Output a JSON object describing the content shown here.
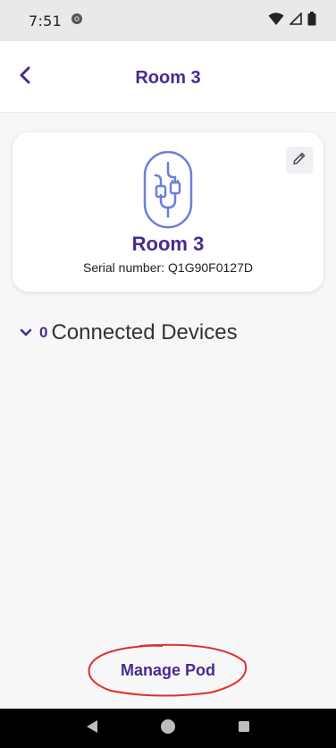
{
  "status_bar": {
    "time": "7:51",
    "icons": [
      "chrome-icon",
      "wifi-icon",
      "signal-icon",
      "battery-icon"
    ]
  },
  "header": {
    "title": "Room 3",
    "back_icon": "chevron-left-icon"
  },
  "pod": {
    "name": "Room 3",
    "serial_label": "Serial number:",
    "serial_value": "Q1G90F0127D",
    "icon": "pod-icon",
    "edit_icon": "pencil-icon"
  },
  "devices": {
    "count": "0",
    "label": "Connected Devices",
    "toggle_icon": "chevron-down-icon"
  },
  "actions": {
    "manage_label": "Manage Pod"
  },
  "nav": {
    "icons": [
      "back-triangle-icon",
      "home-circle-icon",
      "recents-square-icon"
    ]
  },
  "colors": {
    "accent": "#4a2a8f",
    "icon_blue": "#6b7fd8",
    "annotation_red": "#e03030"
  }
}
